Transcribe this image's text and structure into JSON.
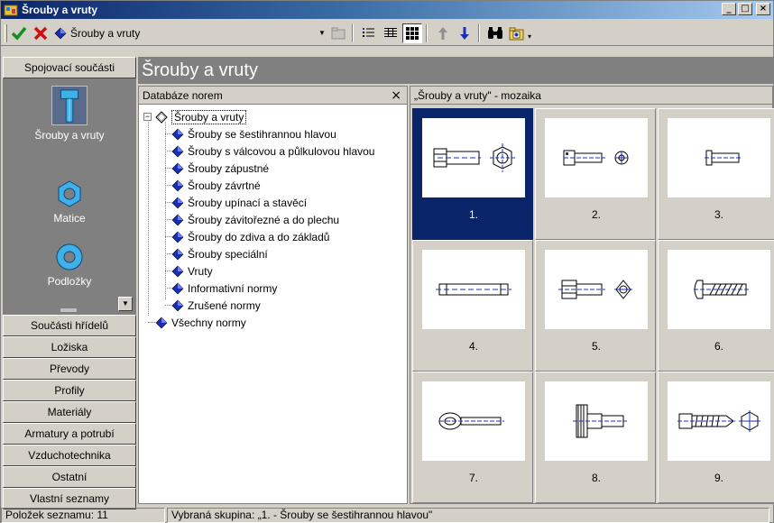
{
  "window": {
    "title": "Šrouby a vruty"
  },
  "toolbar": {
    "combo_value": "Šrouby a vruty"
  },
  "left": {
    "top_category": "Spojovací součásti",
    "gallery": [
      {
        "label": "Šrouby a vruty",
        "icon": "bolt-icon"
      },
      {
        "label": "Matice",
        "icon": "nut-icon"
      },
      {
        "label": "Podložky",
        "icon": "washer-icon"
      }
    ],
    "categories": [
      "Součásti hřídelů",
      "Ložiska",
      "Převody",
      "Profily",
      "Materiály",
      "Armatury a potrubí",
      "Vzduchotechnika",
      "Ostatní",
      "Vlastní seznamy"
    ]
  },
  "header": {
    "title": "Šrouby a vruty"
  },
  "tree_panel": {
    "title": "Databáze norem",
    "close": "×",
    "root": "Šrouby a vruty",
    "children": [
      "Šrouby se šestihrannou hlavou",
      "Šrouby s válcovou a půlkulovou hlavou",
      "Šrouby zápustné",
      "Šrouby závrtné",
      "Šrouby upínací a stavěcí",
      "Šrouby závitořezné a do plechu",
      "Šrouby do zdiva a do základů",
      "Šrouby speciální",
      "Vruty",
      "Informativní normy",
      "Zrušené normy"
    ],
    "all_norms": "Všechny normy"
  },
  "mosaic": {
    "title": "„Šrouby a vruty\" - mozaika",
    "tiles": [
      "1.",
      "2.",
      "3.",
      "4.",
      "5.",
      "6.",
      "7.",
      "8.",
      "9."
    ],
    "selected_index": 0
  },
  "status": {
    "count": "Položek seznamu: 11",
    "group": "Vybraná skupina: „1. - Šrouby se šestihrannou hlavou\""
  },
  "colors": {
    "title_start": "#0a246a",
    "title_end": "#a6caf0",
    "selection": "#0a246a",
    "icon_blue": "#1a2fb8",
    "gallery_bg": "#808080"
  }
}
